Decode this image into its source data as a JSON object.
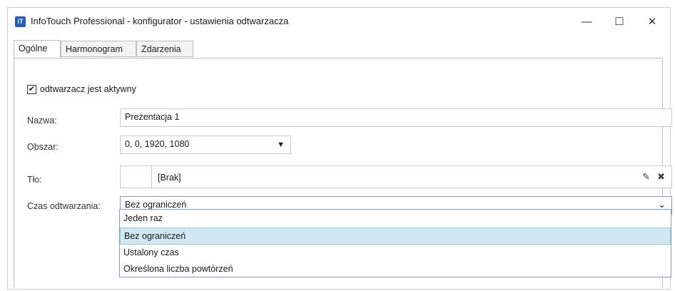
{
  "window": {
    "title": "InfoTouch Professional - konfigurator - ustawienia odtwarzacza",
    "icon_label": "iT",
    "minimize": "—",
    "maximize": "☐",
    "close": "✕"
  },
  "tabs": [
    {
      "label": "Ogólne",
      "active": true
    },
    {
      "label": "Harmonogram",
      "active": false
    },
    {
      "label": "Zdarzenia",
      "active": false
    }
  ],
  "form": {
    "active_checkbox": {
      "label": "odtwarzacz jest aktywny",
      "checked": true,
      "mark": "✔"
    },
    "name": {
      "label": "Nazwa:",
      "value": "Prezentacja 1"
    },
    "area": {
      "label": "Obszar:",
      "value": "0, 0, 1920, 1080",
      "arrow": "▼"
    },
    "background": {
      "label": "Tło:",
      "value": "[Brak]",
      "edit_icon": "✎",
      "clear_icon": "✖"
    },
    "playback_time": {
      "label": "Czas odtwarzania:",
      "value": "Bez ograniczeń",
      "arrow": "⌄",
      "options": [
        "Jeden raz",
        "Bez ograniczeń",
        "Ustalony czas",
        "Określona liczba powtórzeń"
      ],
      "selected_index": 1
    }
  },
  "colors": {
    "selection": "#cfe8f4",
    "accent_border": "#7a9ec2",
    "app_icon": "#1f5fbf"
  }
}
